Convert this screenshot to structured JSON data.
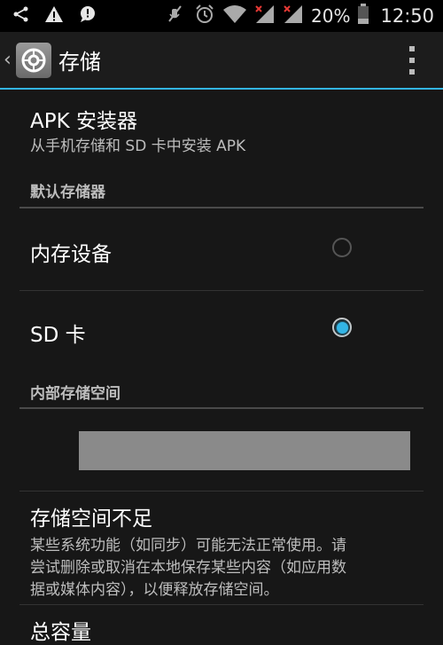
{
  "status_bar": {
    "battery_percent": "20%",
    "time": "12:50",
    "icons": [
      "share-icon",
      "warning-icon",
      "chat-icon",
      "mute-icon",
      "alarm-icon",
      "wifi-icon",
      "signal-icon",
      "signal-icon",
      "battery-icon"
    ]
  },
  "action_bar": {
    "title": "存储",
    "icons": [
      "back-chevron-icon",
      "storage-settings-icon",
      "overflow-menu-icon"
    ]
  },
  "prefs": {
    "apk_installer": {
      "title": "APK 安装器",
      "summary": "从手机存储和 SD 卡中安装 APK"
    },
    "default_storage_header": "默认存储器",
    "options": [
      {
        "label": "内存设备",
        "checked": false
      },
      {
        "label": "SD 卡",
        "checked": true
      }
    ],
    "internal_storage_header": "内部存储空间",
    "low_storage": {
      "title": "存储空间不足",
      "summary_lines": [
        "某些系统功能（如同步）可能无法正常使用。请",
        "尝试删除或取消在本地保存某些内容（如应用数",
        "据或媒体内容），以便释放存储空间。"
      ]
    },
    "total_capacity": "总容量"
  },
  "colors": {
    "accent": "#33b5e5",
    "background": "#171717"
  }
}
